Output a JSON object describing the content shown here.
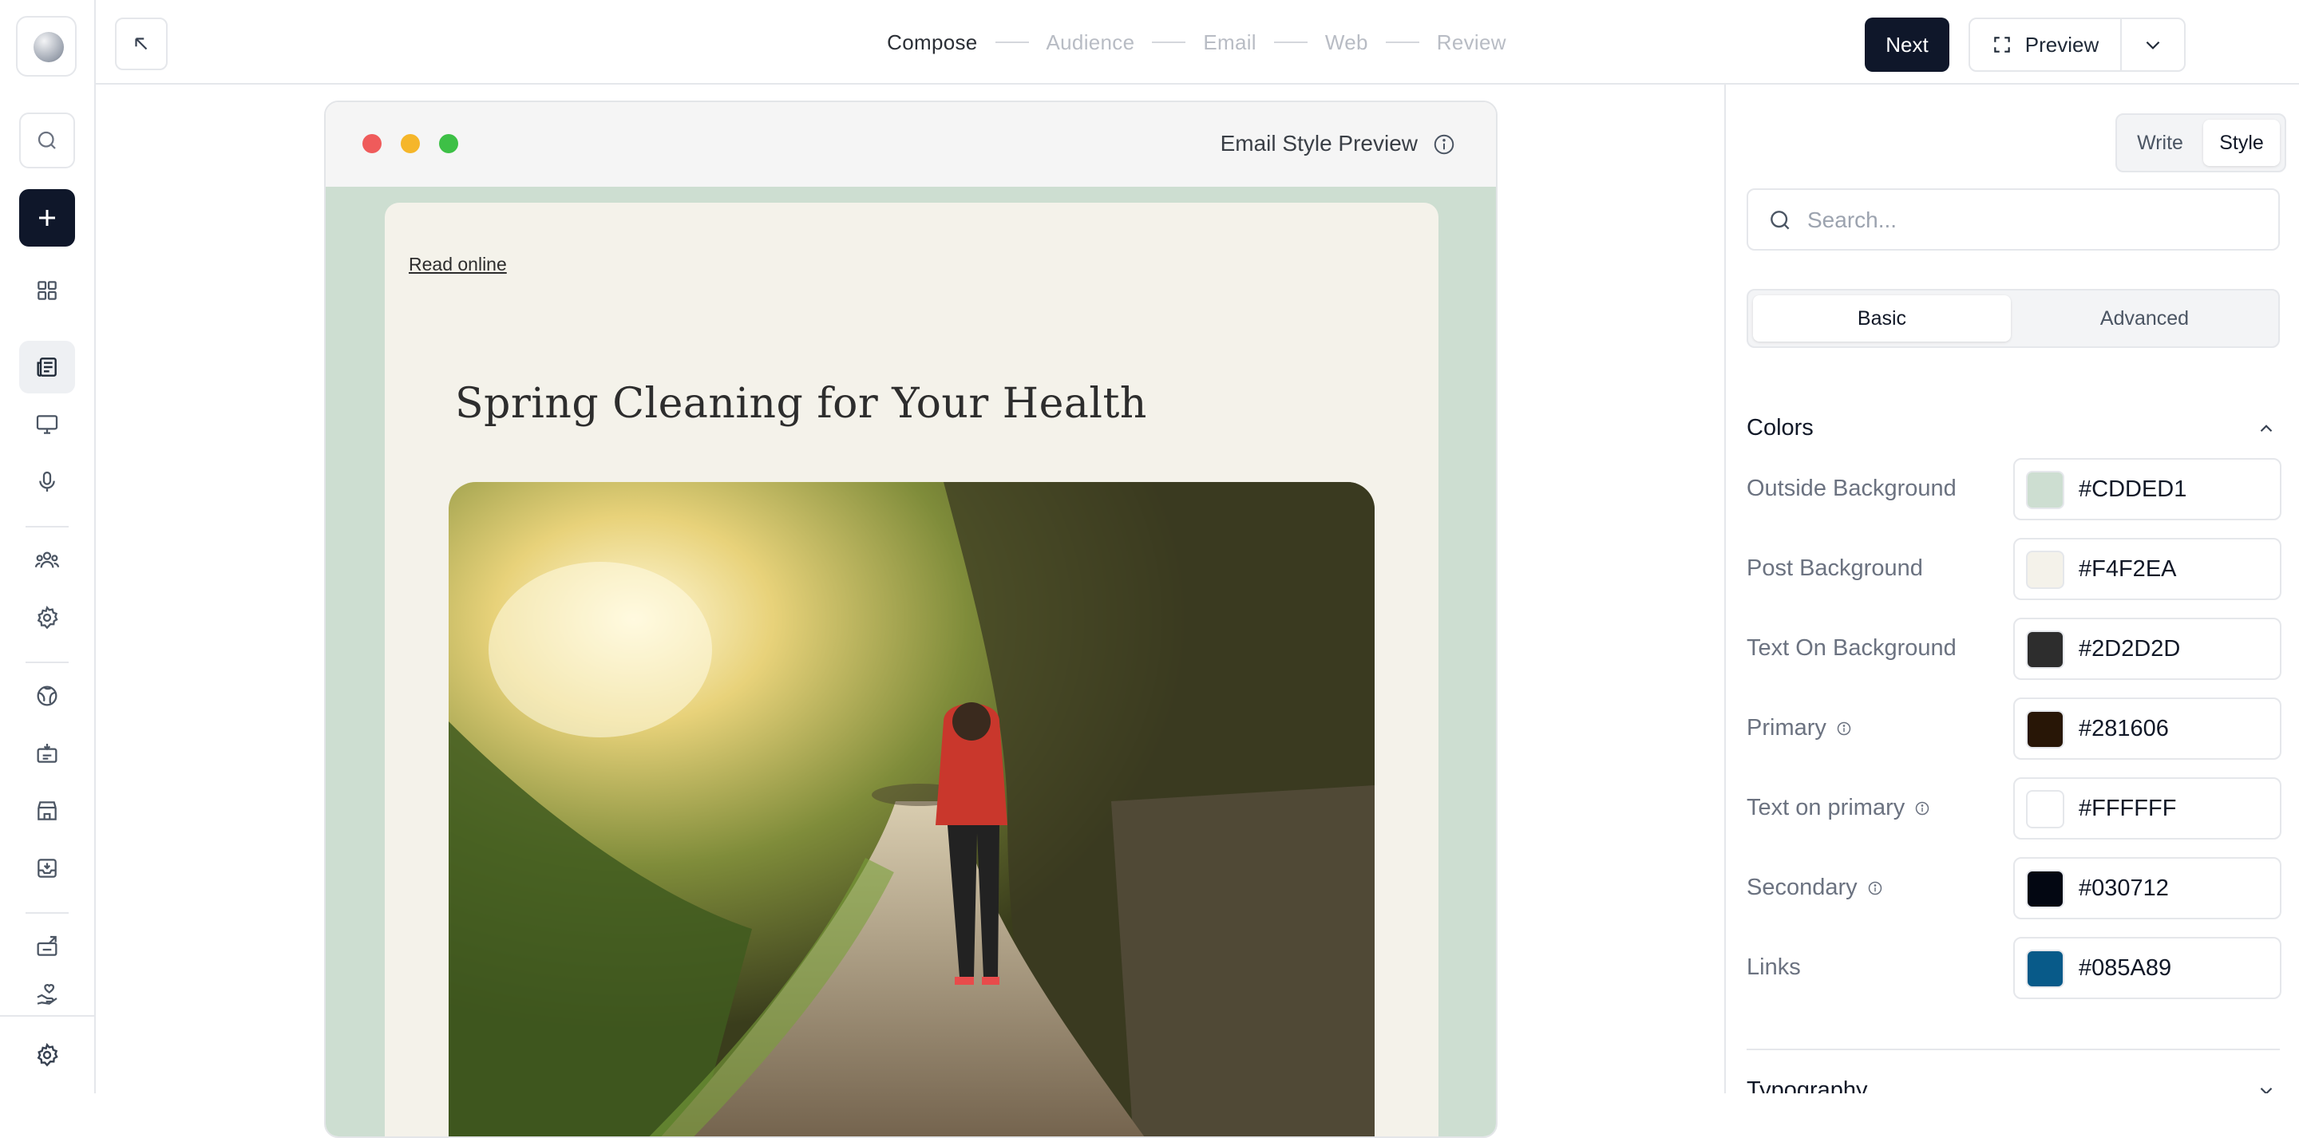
{
  "steps": {
    "compose": "Compose",
    "audience": "Audience",
    "email": "Email",
    "web": "Web",
    "review": "Review"
  },
  "header": {
    "next_label": "Next",
    "preview_label": "Preview"
  },
  "preview_window": {
    "title": "Email Style Preview",
    "read_online": "Read online",
    "headline": "Spring Cleaning for Your Health"
  },
  "panel": {
    "mode_tabs": [
      "Write",
      "Style"
    ],
    "active_mode": "Style",
    "search_placeholder": "Search...",
    "level_tabs": [
      "Basic",
      "Advanced"
    ],
    "active_level": "Basic",
    "colors_title": "Colors",
    "colors": [
      {
        "label": "Outside Background",
        "value": "#CDDED1",
        "info": false
      },
      {
        "label": "Post Background",
        "value": "#F4F2EA",
        "info": false
      },
      {
        "label": "Text On Background",
        "value": "#2D2D2D",
        "info": false
      },
      {
        "label": "Primary",
        "value": "#281606",
        "info": true
      },
      {
        "label": "Text on primary",
        "value": "#FFFFFF",
        "info": true
      },
      {
        "label": "Secondary",
        "value": "#030712",
        "info": true
      },
      {
        "label": "Links",
        "value": "#085A89",
        "info": false
      }
    ],
    "typography_title": "Typography"
  },
  "icons": {
    "rail": [
      "search-icon",
      "plus-icon",
      "grid-icon",
      "posts-icon",
      "monitor-icon",
      "microphone-icon",
      "users-icon",
      "gear-icon",
      "globe-icon",
      "box-icon",
      "store-icon",
      "inbox-icon",
      "export-icon",
      "heart-hand-icon",
      "settings-icon"
    ]
  },
  "theme": {
    "dark": "#0f172a",
    "border": "#e5e7eb",
    "window_dots": [
      "#ef5b5b",
      "#f5b62a",
      "#3dc046"
    ]
  }
}
